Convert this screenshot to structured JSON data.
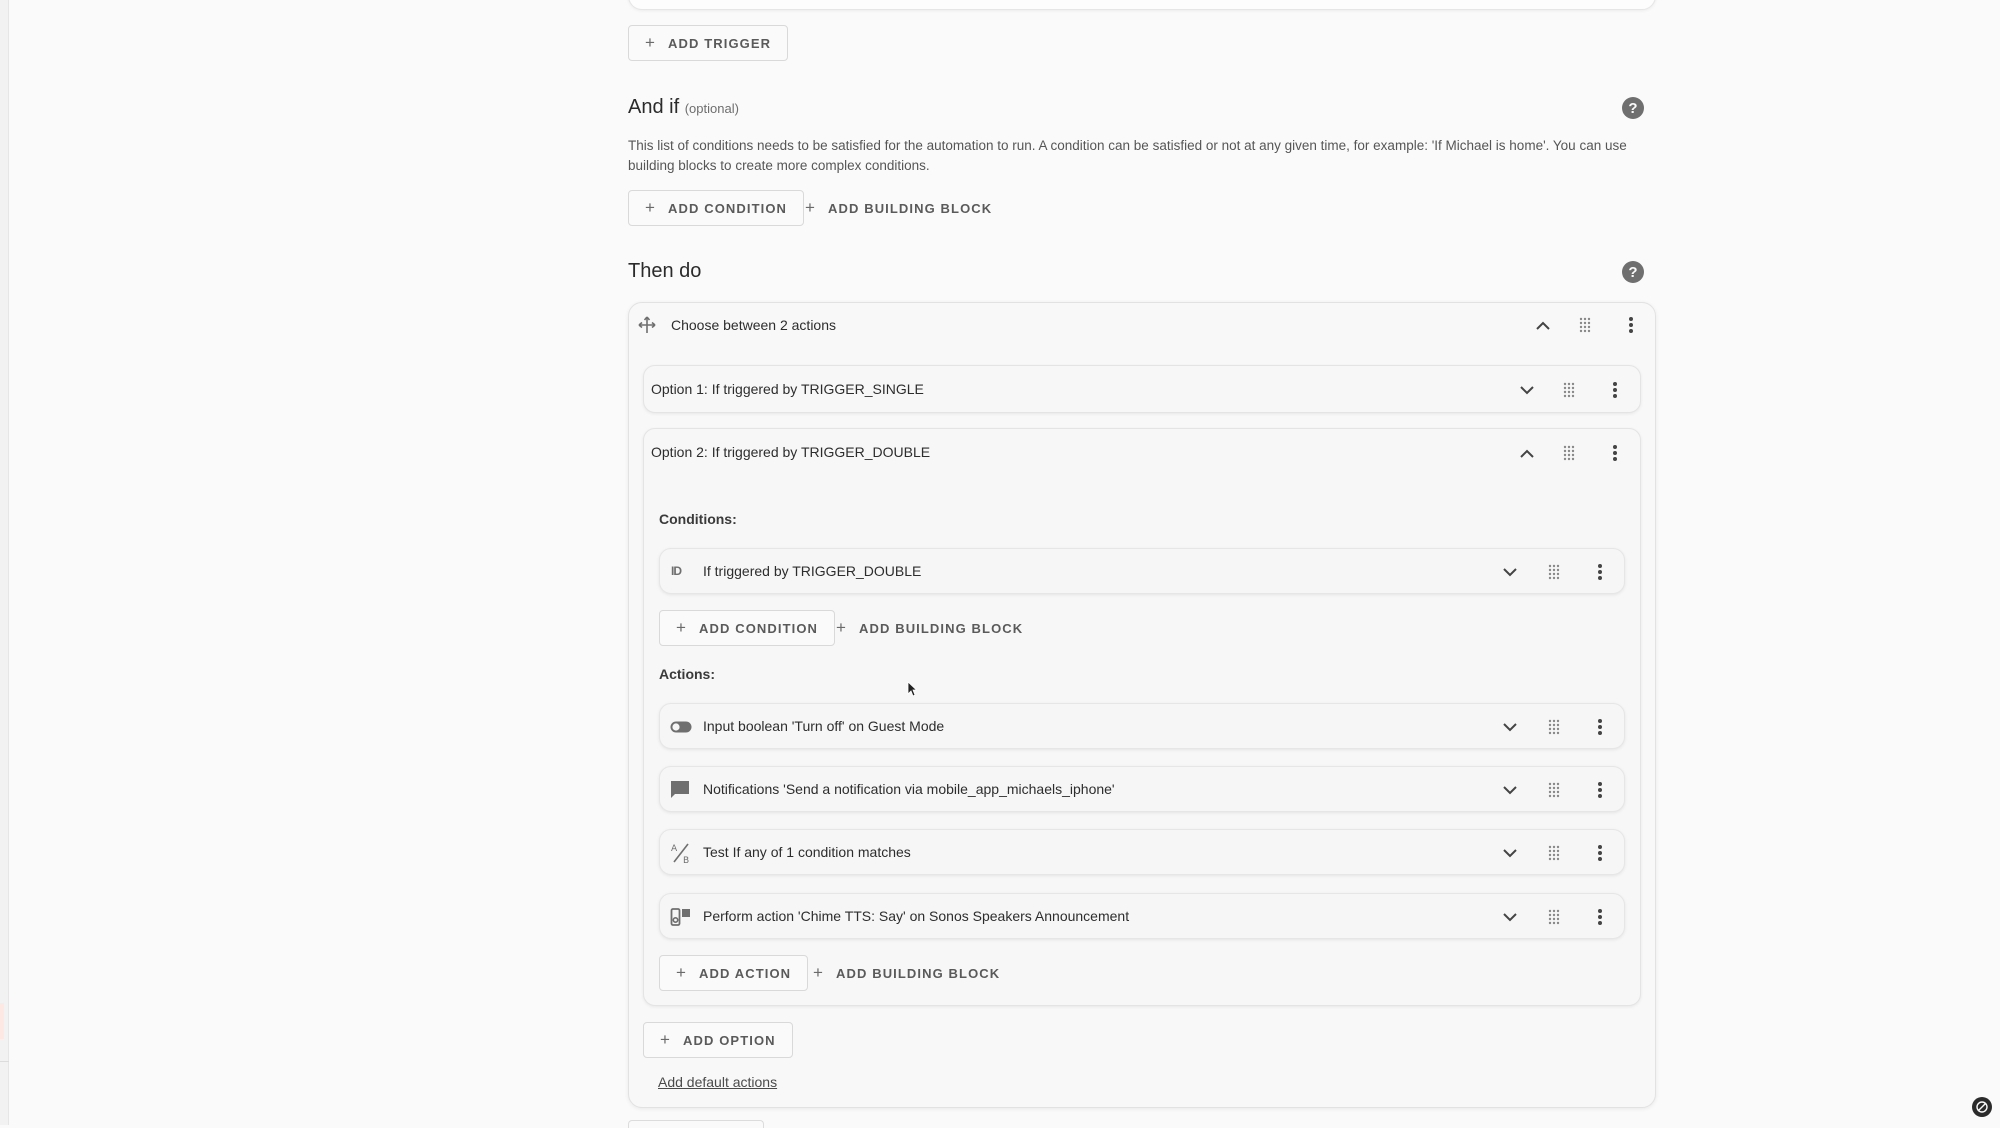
{
  "triggers": {
    "add_trigger_label": "ADD TRIGGER"
  },
  "and_if": {
    "title": "And if",
    "optional": "(optional)",
    "description": "This list of conditions needs to be satisfied for the automation to run. A condition can be satisfied or not at any given time, for example: 'If Michael is home'. You can use building blocks to create more complex conditions.",
    "add_condition_label": "ADD CONDITION",
    "add_building_block_label": "ADD BUILDING BLOCK"
  },
  "then_do": {
    "title": "Then do",
    "choose": {
      "title": "Choose between 2 actions",
      "option1": {
        "title": "Option 1: If triggered by TRIGGER_SINGLE"
      },
      "option2": {
        "title": "Option 2: If triggered by TRIGGER_DOUBLE",
        "conditions_label": "Conditions:",
        "condition_item": "If triggered by TRIGGER_DOUBLE",
        "add_condition_label": "ADD CONDITION",
        "add_building_block_label": "ADD BUILDING BLOCK",
        "actions_label": "Actions:",
        "actions": [
          {
            "title": "Input boolean 'Turn off' on Guest Mode",
            "icon": "toggle-icon"
          },
          {
            "title": "Notifications 'Send a notification via mobile_app_michaels_iphone'",
            "icon": "message-icon"
          },
          {
            "title": "Test If any of 1 condition matches",
            "icon": "ab-test-icon"
          },
          {
            "title": "Perform action 'Chime TTS: Say' on Sonos Speakers Announcement",
            "icon": "service-icon"
          }
        ],
        "add_action_label": "ADD ACTION",
        "add_action_building_block_label": "ADD BUILDING BLOCK"
      },
      "add_option_label": "ADD OPTION",
      "add_default_actions_label": "Add default actions"
    }
  },
  "colors": {
    "background": "#fafafa",
    "card": "#f8f8f8",
    "icon": "#6f6f6f"
  }
}
